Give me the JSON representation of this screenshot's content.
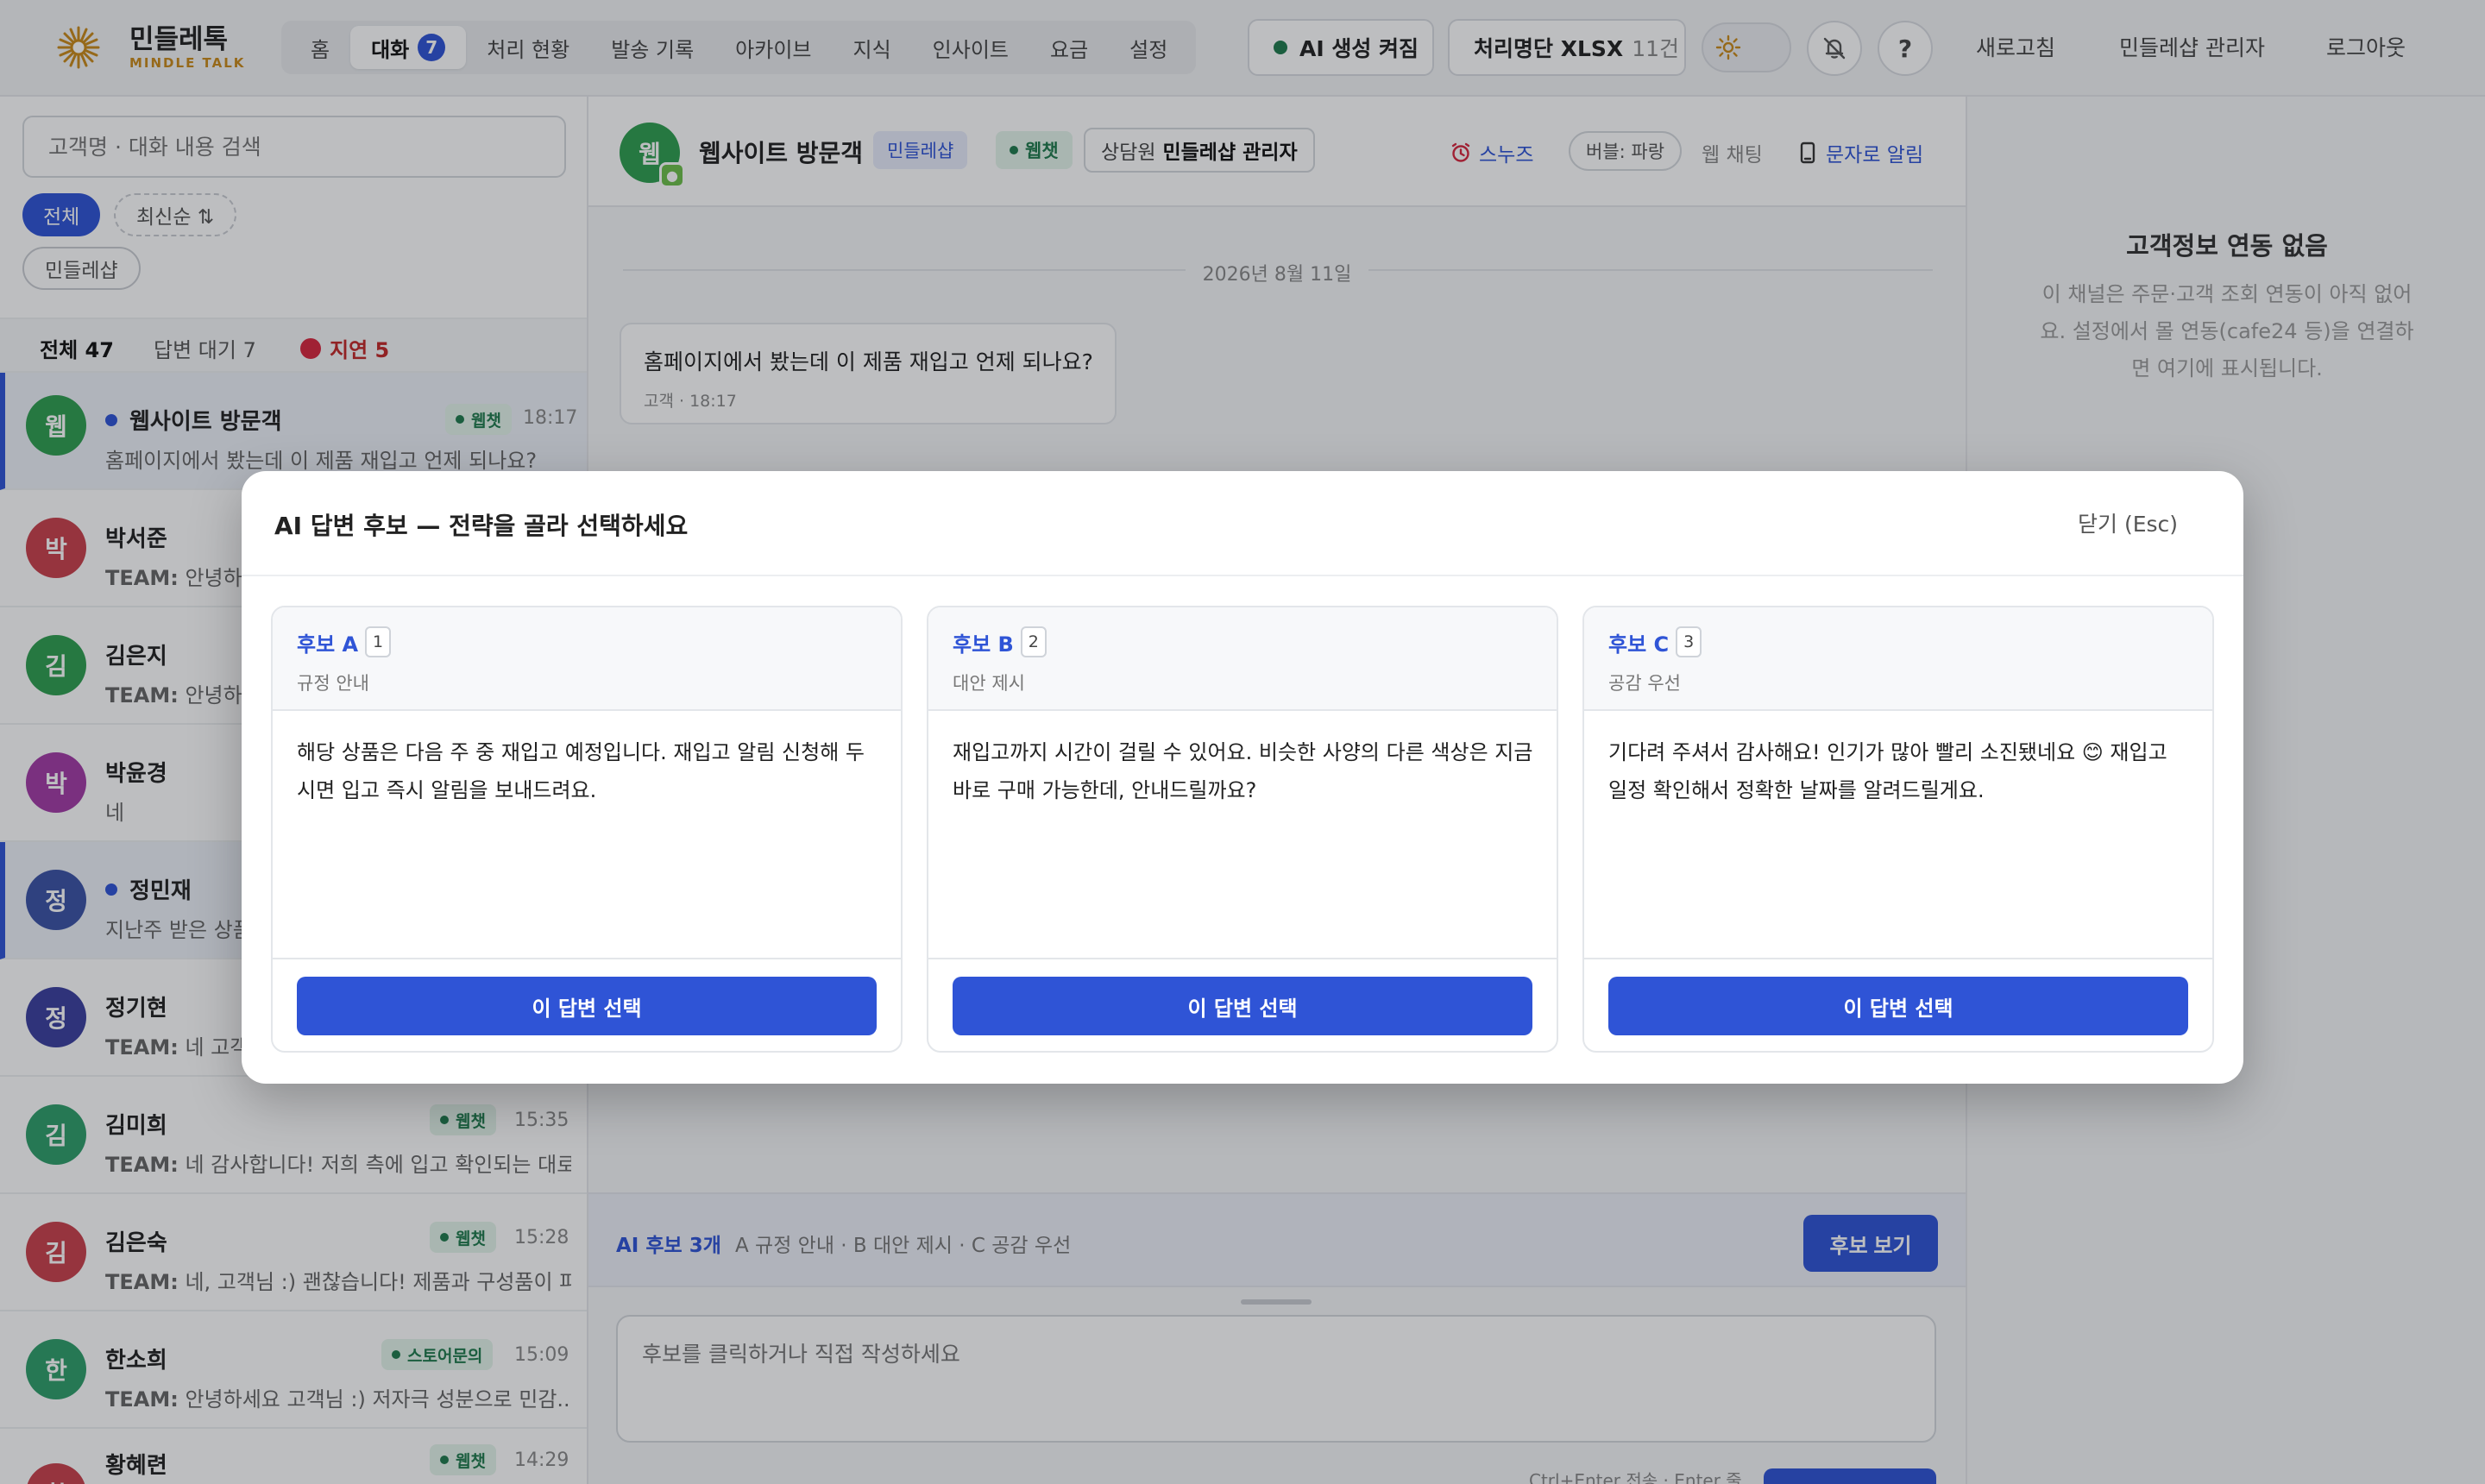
{
  "brand": {
    "name": "민들레톡",
    "sub": "MINDLE TALK",
    "accent": "#c98a1a"
  },
  "nav": {
    "items": [
      "홈",
      "대화",
      "처리 현황",
      "발송 기록",
      "아카이브",
      "지식",
      "인사이트",
      "요금",
      "설정"
    ],
    "active": "대화",
    "chat_badge": "7"
  },
  "toolbar": {
    "ai_label": "AI 생성 켜짐",
    "xlsx_label": "처리명단 XLSX",
    "xlsx_count": "11건",
    "help": "?",
    "refresh": "새로고침",
    "admin": "민들레샵 관리자",
    "logout": "로그아웃"
  },
  "sidebar": {
    "search_placeholder": "고객명 · 대화 내용 검색",
    "filters": {
      "all": "전체",
      "sort": "최신순 ⇅",
      "shop": "민들레샵"
    },
    "tabs": {
      "all": "전체 47",
      "waiting": "답변 대기 7",
      "delayed": "지연 5"
    },
    "conversations": [
      {
        "initial": "웹",
        "name": "웹사이트 방문객",
        "preview": "홈페이지에서 봤는데 이 제품 재입고 언제 되나요?",
        "tag": "웹챗",
        "time": "18:17",
        "unread": true,
        "prefix": ""
      },
      {
        "initial": "박",
        "name": "박서준",
        "preview": "안녕하세",
        "tag": "",
        "time": "",
        "unread": false,
        "prefix": "TEAM:"
      },
      {
        "initial": "김",
        "name": "김은지",
        "preview": "안녕하세",
        "tag": "",
        "time": "",
        "unread": false,
        "prefix": "TEAM:"
      },
      {
        "initial": "박",
        "name": "박윤경",
        "preview": "네",
        "tag": "",
        "time": "",
        "unread": false,
        "prefix": ""
      },
      {
        "initial": "정",
        "name": "정민재",
        "preview": "지난주 받은 상품",
        "tag": "",
        "time": "",
        "unread": true,
        "prefix": ""
      },
      {
        "initial": "정",
        "name": "정기현",
        "preview": "네 고객님",
        "tag": "",
        "time": "",
        "unread": false,
        "prefix": "TEAM:"
      },
      {
        "initial": "김",
        "name": "김미희",
        "preview": "네 감사합니다! 저희 측에 입고 확인되는 대로...",
        "tag": "웹챗",
        "time": "15:35",
        "unread": false,
        "prefix": "TEAM:"
      },
      {
        "initial": "김",
        "name": "김은숙",
        "preview": "네, 고객님 :) 괜찮습니다! 제품과 구성품이 파...",
        "tag": "웹챗",
        "time": "15:28",
        "unread": false,
        "prefix": "TEAM:"
      },
      {
        "initial": "한",
        "name": "한소희",
        "preview": "안녕하세요 고객님 :) 저자극 성분으로 민감...",
        "tag": "스토어문의",
        "time": "15:09",
        "unread": false,
        "prefix": "TEAM:"
      },
      {
        "initial": "황",
        "name": "황혜련",
        "preview": "",
        "tag": "웹챗",
        "time": "14:29",
        "unread": false,
        "prefix": ""
      }
    ]
  },
  "chat": {
    "avatar_initial": "웹",
    "title": "웹사이트 방문객",
    "shop_badge": "민들레샵",
    "channel_badge": "웹챗",
    "agent_label": "상담원",
    "agent_name": "민들레샵 관리자",
    "snooze": "스누즈",
    "bubble": "버블: 파랑",
    "webchat": "웹 채팅",
    "sms": "문자로 알림",
    "date": "2026년 8월 11일",
    "message": {
      "text": "홈페이지에서 봤는데 이 제품 재입고 언제 되나요?",
      "meta": "고객 · 18:17"
    },
    "ai_bar": {
      "title": "AI 후보 3개",
      "desc": "A 규정 안내 · B 대안 제시 · C 공감 우선",
      "button": "후보 보기"
    },
    "composer_placeholder": "후보를 클릭하거나 직접 작성하세요",
    "hint": "Ctrl+Enter 전송 · Enter 줄"
  },
  "right_panel": {
    "title": "고객정보 연동 없음",
    "body": "이 채널은 주문·고객 조회 연동이 아직 없어요. 설정에서 몰 연동(cafe24 등)을 연결하면 여기에 표시됩니다."
  },
  "modal": {
    "title": "AI 답변 후보 — 전략을 골라 선택하세요",
    "close": "닫기 (Esc)",
    "candidates": [
      {
        "label": "후보 A",
        "key": "1",
        "strategy": "규정 안내",
        "body": "해당 상품은 다음 주 중 재입고 예정입니다. 재입고 알림 신청해 두시면 입고 즉시 알림을 보내드려요.",
        "button": "이 답변 선택"
      },
      {
        "label": "후보 B",
        "key": "2",
        "strategy": "대안 제시",
        "body": "재입고까지 시간이 걸릴 수 있어요. 비슷한 사양의 다른 색상은 지금 바로 구매 가능한데, 안내드릴까요?",
        "button": "이 답변 선택"
      },
      {
        "label": "후보 C",
        "key": "3",
        "strategy": "공감 우선",
        "body": "기다려 주셔서 감사해요! 인기가 많아 빨리 소진됐네요 😊 재입고 일정 확인해서 정확한 날짜를 알려드릴게요.",
        "button": "이 답변 선택"
      }
    ]
  },
  "colors": {
    "primary": "#2f54d6",
    "green": "#1f7a4d",
    "red": "#d7263d"
  }
}
